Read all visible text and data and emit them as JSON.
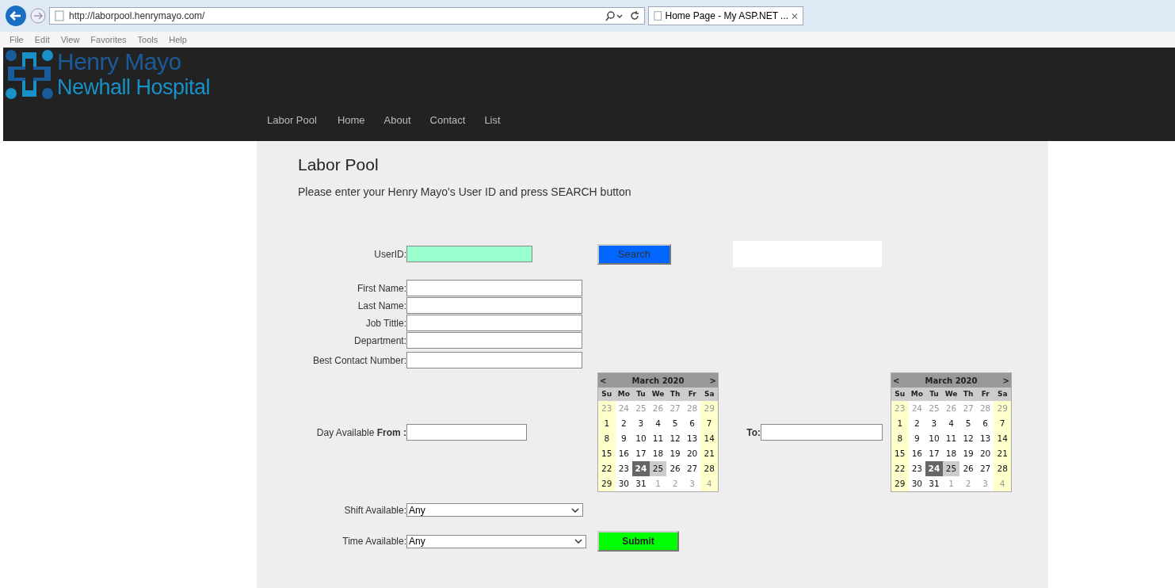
{
  "browser": {
    "address": "http://laborpool.henrymayo.com/",
    "tab_title": "Home Page - My ASP.NET ...",
    "menu": [
      "File",
      "Edit",
      "View",
      "Favorites",
      "Tools",
      "Help"
    ]
  },
  "header": {
    "logo_line1": "Henry Mayo",
    "logo_line2": "Newhall Hospital",
    "brand": "Labor Pool",
    "nav": [
      "Home",
      "About",
      "Contact",
      "List"
    ]
  },
  "page": {
    "title": "Labor Pool",
    "intro": "Please enter your Henry Mayo's User ID and press SEARCH button"
  },
  "userid": {
    "label": "UserID:"
  },
  "search_button": "Search",
  "fields": [
    {
      "label": "First Name:"
    },
    {
      "label": "Last Name:"
    },
    {
      "label": "Job Tittle:"
    },
    {
      "label": "Department:"
    },
    {
      "label": "Best Contact Number:"
    }
  ],
  "day_from": {
    "label": "Day Available ",
    "label_bold": "From :"
  },
  "day_to": {
    "label": "To:"
  },
  "calendars": [
    {
      "prev": "<",
      "next": ">",
      "title": "March 2020",
      "weekdays": [
        "Su",
        "Mo",
        "Tu",
        "We",
        "Th",
        "Fr",
        "Sa"
      ],
      "weeks": [
        [
          {
            "d": "23",
            "other_month": true,
            "selected": false,
            "today": false
          },
          {
            "d": "24",
            "other_month": true,
            "selected": false,
            "today": false
          },
          {
            "d": "25",
            "other_month": true,
            "selected": false,
            "today": false
          },
          {
            "d": "26",
            "other_month": true,
            "selected": false,
            "today": false
          },
          {
            "d": "27",
            "other_month": true,
            "selected": false,
            "today": false
          },
          {
            "d": "28",
            "other_month": true,
            "selected": false,
            "today": false
          },
          {
            "d": "29",
            "other_month": true,
            "selected": false,
            "today": false
          }
        ],
        [
          {
            "d": "1",
            "other_month": false,
            "selected": false,
            "today": false
          },
          {
            "d": "2",
            "other_month": false,
            "selected": false,
            "today": false
          },
          {
            "d": "3",
            "other_month": false,
            "selected": false,
            "today": false
          },
          {
            "d": "4",
            "other_month": false,
            "selected": false,
            "today": false
          },
          {
            "d": "5",
            "other_month": false,
            "selected": false,
            "today": false
          },
          {
            "d": "6",
            "other_month": false,
            "selected": false,
            "today": false
          },
          {
            "d": "7",
            "other_month": false,
            "selected": false,
            "today": false
          }
        ],
        [
          {
            "d": "8",
            "other_month": false,
            "selected": false,
            "today": false
          },
          {
            "d": "9",
            "other_month": false,
            "selected": false,
            "today": false
          },
          {
            "d": "10",
            "other_month": false,
            "selected": false,
            "today": false
          },
          {
            "d": "11",
            "other_month": false,
            "selected": false,
            "today": false
          },
          {
            "d": "12",
            "other_month": false,
            "selected": false,
            "today": false
          },
          {
            "d": "13",
            "other_month": false,
            "selected": false,
            "today": false
          },
          {
            "d": "14",
            "other_month": false,
            "selected": false,
            "today": false
          }
        ],
        [
          {
            "d": "15",
            "other_month": false,
            "selected": false,
            "today": false
          },
          {
            "d": "16",
            "other_month": false,
            "selected": false,
            "today": false
          },
          {
            "d": "17",
            "other_month": false,
            "selected": false,
            "today": false
          },
          {
            "d": "18",
            "other_month": false,
            "selected": false,
            "today": false
          },
          {
            "d": "19",
            "other_month": false,
            "selected": false,
            "today": false
          },
          {
            "d": "20",
            "other_month": false,
            "selected": false,
            "today": false
          },
          {
            "d": "21",
            "other_month": false,
            "selected": false,
            "today": false
          }
        ],
        [
          {
            "d": "22",
            "other_month": false,
            "selected": false,
            "today": false
          },
          {
            "d": "23",
            "other_month": false,
            "selected": false,
            "today": false
          },
          {
            "d": "24",
            "other_month": false,
            "selected": true,
            "today": false
          },
          {
            "d": "25",
            "other_month": false,
            "selected": false,
            "today": true
          },
          {
            "d": "26",
            "other_month": false,
            "selected": false,
            "today": false
          },
          {
            "d": "27",
            "other_month": false,
            "selected": false,
            "today": false
          },
          {
            "d": "28",
            "other_month": false,
            "selected": false,
            "today": false
          }
        ],
        [
          {
            "d": "29",
            "other_month": false,
            "selected": false,
            "today": false
          },
          {
            "d": "30",
            "other_month": false,
            "selected": false,
            "today": false
          },
          {
            "d": "31",
            "other_month": false,
            "selected": false,
            "today": false
          },
          {
            "d": "1",
            "other_month": true,
            "selected": false,
            "today": false
          },
          {
            "d": "2",
            "other_month": true,
            "selected": false,
            "today": false
          },
          {
            "d": "3",
            "other_month": true,
            "selected": false,
            "today": false
          },
          {
            "d": "4",
            "other_month": true,
            "selected": false,
            "today": false
          }
        ]
      ]
    },
    {
      "prev": "<",
      "next": ">",
      "title": "March 2020",
      "weekdays": [
        "Su",
        "Mo",
        "Tu",
        "We",
        "Th",
        "Fr",
        "Sa"
      ],
      "weeks": [
        [
          {
            "d": "23",
            "other_month": true,
            "selected": false,
            "today": false
          },
          {
            "d": "24",
            "other_month": true,
            "selected": false,
            "today": false
          },
          {
            "d": "25",
            "other_month": true,
            "selected": false,
            "today": false
          },
          {
            "d": "26",
            "other_month": true,
            "selected": false,
            "today": false
          },
          {
            "d": "27",
            "other_month": true,
            "selected": false,
            "today": false
          },
          {
            "d": "28",
            "other_month": true,
            "selected": false,
            "today": false
          },
          {
            "d": "29",
            "other_month": true,
            "selected": false,
            "today": false
          }
        ],
        [
          {
            "d": "1",
            "other_month": false,
            "selected": false,
            "today": false
          },
          {
            "d": "2",
            "other_month": false,
            "selected": false,
            "today": false
          },
          {
            "d": "3",
            "other_month": false,
            "selected": false,
            "today": false
          },
          {
            "d": "4",
            "other_month": false,
            "selected": false,
            "today": false
          },
          {
            "d": "5",
            "other_month": false,
            "selected": false,
            "today": false
          },
          {
            "d": "6",
            "other_month": false,
            "selected": false,
            "today": false
          },
          {
            "d": "7",
            "other_month": false,
            "selected": false,
            "today": false
          }
        ],
        [
          {
            "d": "8",
            "other_month": false,
            "selected": false,
            "today": false
          },
          {
            "d": "9",
            "other_month": false,
            "selected": false,
            "today": false
          },
          {
            "d": "10",
            "other_month": false,
            "selected": false,
            "today": false
          },
          {
            "d": "11",
            "other_month": false,
            "selected": false,
            "today": false
          },
          {
            "d": "12",
            "other_month": false,
            "selected": false,
            "today": false
          },
          {
            "d": "13",
            "other_month": false,
            "selected": false,
            "today": false
          },
          {
            "d": "14",
            "other_month": false,
            "selected": false,
            "today": false
          }
        ],
        [
          {
            "d": "15",
            "other_month": false,
            "selected": false,
            "today": false
          },
          {
            "d": "16",
            "other_month": false,
            "selected": false,
            "today": false
          },
          {
            "d": "17",
            "other_month": false,
            "selected": false,
            "today": false
          },
          {
            "d": "18",
            "other_month": false,
            "selected": false,
            "today": false
          },
          {
            "d": "19",
            "other_month": false,
            "selected": false,
            "today": false
          },
          {
            "d": "20",
            "other_month": false,
            "selected": false,
            "today": false
          },
          {
            "d": "21",
            "other_month": false,
            "selected": false,
            "today": false
          }
        ],
        [
          {
            "d": "22",
            "other_month": false,
            "selected": false,
            "today": false
          },
          {
            "d": "23",
            "other_month": false,
            "selected": false,
            "today": false
          },
          {
            "d": "24",
            "other_month": false,
            "selected": true,
            "today": false
          },
          {
            "d": "25",
            "other_month": false,
            "selected": false,
            "today": true
          },
          {
            "d": "26",
            "other_month": false,
            "selected": false,
            "today": false
          },
          {
            "d": "27",
            "other_month": false,
            "selected": false,
            "today": false
          },
          {
            "d": "28",
            "other_month": false,
            "selected": false,
            "today": false
          }
        ],
        [
          {
            "d": "29",
            "other_month": false,
            "selected": false,
            "today": false
          },
          {
            "d": "30",
            "other_month": false,
            "selected": false,
            "today": false
          },
          {
            "d": "31",
            "other_month": false,
            "selected": false,
            "today": false
          },
          {
            "d": "1",
            "other_month": true,
            "selected": false,
            "today": false
          },
          {
            "d": "2",
            "other_month": true,
            "selected": false,
            "today": false
          },
          {
            "d": "3",
            "other_month": true,
            "selected": false,
            "today": false
          },
          {
            "d": "4",
            "other_month": true,
            "selected": false,
            "today": false
          }
        ]
      ]
    }
  ],
  "shift": {
    "label": "Shift Available:",
    "value": "Any"
  },
  "time": {
    "label": "Time Available:",
    "value": "Any"
  },
  "submit_button": "Submit"
}
